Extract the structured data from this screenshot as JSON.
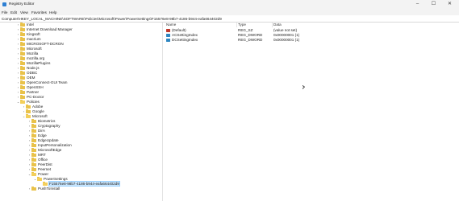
{
  "window": {
    "title": "Registry Editor",
    "controls": {
      "minimize": "–",
      "maximize": "☐",
      "close": "✕"
    }
  },
  "menu": [
    "File",
    "Edit",
    "View",
    "Favorites",
    "Help"
  ],
  "address": "Computer\\HKEY_LOCAL_MACHINE\\SOFTWARE\\Policies\\Microsoft\\Power\\PowerSettings\\F15576e8-98b7-4186-b944-eafa664402d9",
  "tree": {
    "items": [
      {
        "label": "Intel",
        "expanded": false
      },
      {
        "label": "Internet Download Manager",
        "expanded": false
      },
      {
        "label": "Kingsoft",
        "expanded": false
      },
      {
        "label": "macrium",
        "expanded": false
      },
      {
        "label": "MICROSOFT-DCRON",
        "expanded": false
      },
      {
        "label": "Microsoft",
        "expanded": false
      },
      {
        "label": "Mozilla",
        "expanded": false
      },
      {
        "label": "mozilla.org",
        "expanded": false
      },
      {
        "label": "MozillaPlugins",
        "expanded": false
      },
      {
        "label": "Node.js",
        "expanded": false
      },
      {
        "label": "ODBC",
        "expanded": false
      },
      {
        "label": "OEM",
        "expanded": false
      },
      {
        "label": "OpenConnect-GUI Team",
        "expanded": false
      },
      {
        "label": "OpenSSH",
        "expanded": false
      },
      {
        "label": "Partner",
        "expanded": false
      },
      {
        "label": "PC-Doctor",
        "expanded": false
      },
      {
        "label": "Policies",
        "expanded": true
      },
      {
        "label": "Adobe",
        "expanded": false
      },
      {
        "label": "Google",
        "expanded": false
      },
      {
        "label": "Microsoft",
        "expanded": true
      },
      {
        "label": "Biometrics",
        "expanded": false
      },
      {
        "label": "Cryptography",
        "expanded": false
      },
      {
        "label": "DirA",
        "expanded": false
      },
      {
        "label": "Edge",
        "expanded": false
      },
      {
        "label": "EdgeUpdate",
        "expanded": false
      },
      {
        "label": "InputPersonalization",
        "expanded": false
      },
      {
        "label": "MicrosoftEdge",
        "expanded": false
      },
      {
        "label": "MRT",
        "expanded": false
      },
      {
        "label": "Office",
        "expanded": false
      },
      {
        "label": "PeerDist",
        "expanded": false
      },
      {
        "label": "Peernet",
        "expanded": false
      },
      {
        "label": "Power",
        "expanded": true
      },
      {
        "label": "PowerSettings",
        "expanded": true
      },
      {
        "label": "F15576e8-98b7-4186-b944-eafa664402d9",
        "expanded": false
      },
      {
        "label": "PushToInstall",
        "expanded": false
      }
    ]
  },
  "values": {
    "headers": {
      "name": "Name",
      "type": "Type",
      "data": "Data"
    },
    "rows": [
      {
        "name": "(Default)",
        "type": "REG_SZ",
        "data": "(value not set)",
        "kind": "sz"
      },
      {
        "name": "ACSettingIndex",
        "type": "REG_DWORD",
        "data": "0x00000001 (1)",
        "kind": "dw"
      },
      {
        "name": "DCSettingIndex",
        "type": "REG_DWORD",
        "data": "0x00000001 (1)",
        "kind": "dw"
      }
    ]
  },
  "colors": {
    "folder": "#e9c24a",
    "selection": "#cce8ff",
    "chrome": "#f3f3f3"
  }
}
